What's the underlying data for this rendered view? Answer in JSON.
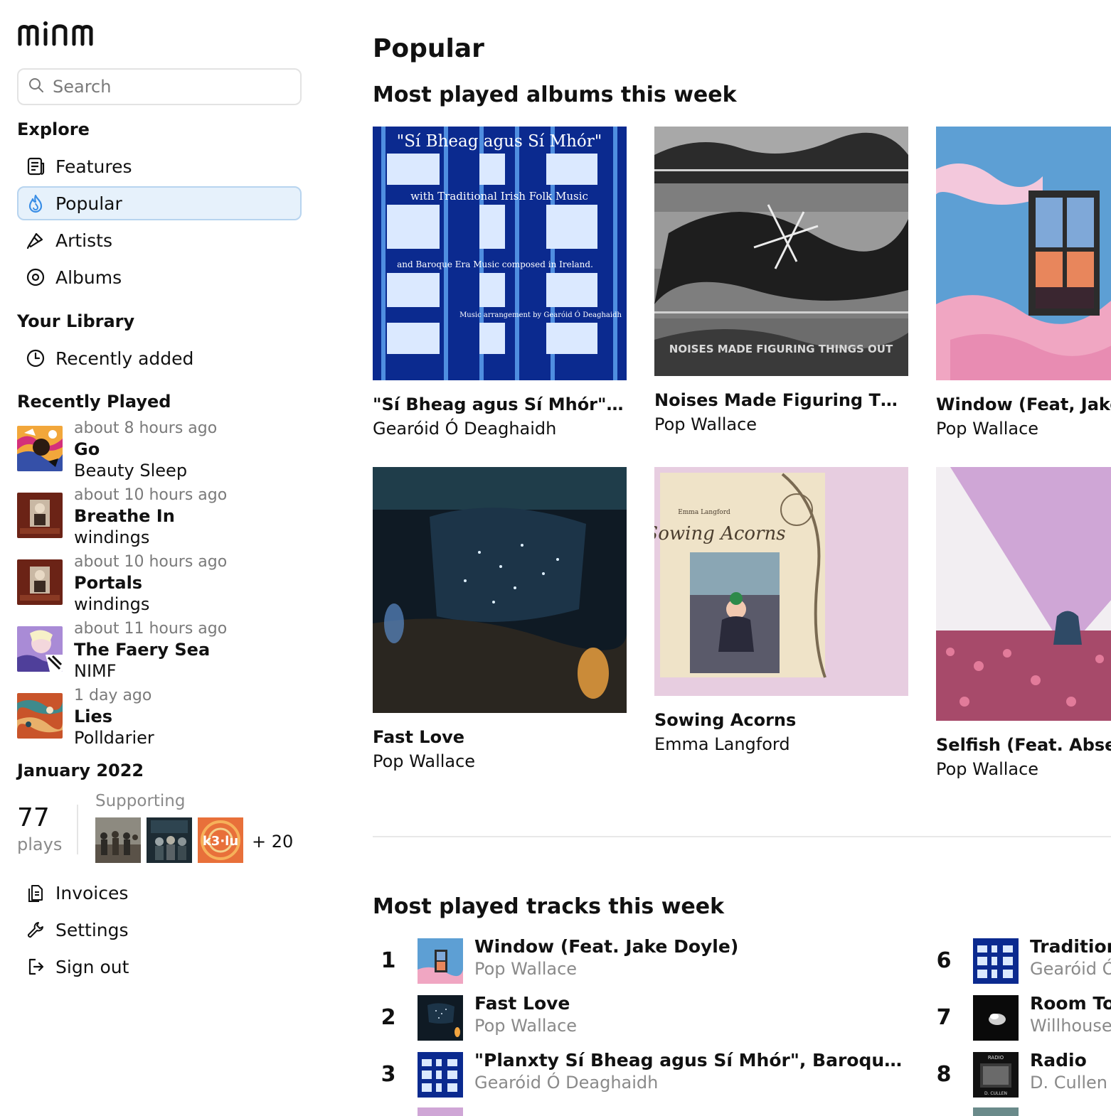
{
  "app": {
    "logo": "minm"
  },
  "search": {
    "placeholder": "Search"
  },
  "explore": {
    "heading": "Explore",
    "items": [
      {
        "label": "Features",
        "icon": "newspaper-icon"
      },
      {
        "label": "Popular",
        "icon": "flame-icon",
        "active": true
      },
      {
        "label": "Artists",
        "icon": "microphone-icon"
      },
      {
        "label": "Albums",
        "icon": "disc-icon"
      }
    ]
  },
  "library": {
    "heading": "Your Library",
    "items": [
      {
        "label": "Recently added",
        "icon": "clock-icon"
      }
    ]
  },
  "recently_played": {
    "heading": "Recently Played",
    "items": [
      {
        "time": "about 8 hours ago",
        "title": "Go",
        "artist": "Beauty Sleep"
      },
      {
        "time": "about 10 hours ago",
        "title": "Breathe In",
        "artist": "windings"
      },
      {
        "time": "about 10 hours ago",
        "title": "Portals",
        "artist": "windings"
      },
      {
        "time": "about 11 hours ago",
        "title": "The Faery Sea",
        "artist": "NIMF"
      },
      {
        "time": "1 day ago",
        "title": "Lies",
        "artist": "Polldarier"
      }
    ]
  },
  "stats": {
    "heading": "January 2022",
    "plays": "77",
    "plays_label": "plays",
    "supporting_label": "Supporting",
    "more": "+ 20"
  },
  "account": {
    "items": [
      {
        "label": "Invoices",
        "icon": "invoice-icon"
      },
      {
        "label": "Settings",
        "icon": "wrench-icon"
      },
      {
        "label": "Sign out",
        "icon": "sign-out-icon"
      }
    ]
  },
  "main": {
    "title": "Popular",
    "albums_heading": "Most played albums this week",
    "albums": [
      {
        "title": "\"Sí Bheag agus Sí Mhór\" with Traditional Irish Folk Music",
        "artist": "Gearóid Ó Deaghaidh",
        "cover_text": "\"Sí Bheag agus Sí Mhór\"",
        "cover_sub1": "with Traditional Irish Folk Music",
        "cover_sub2": "and Baroque Era Music composed in Ireland.",
        "cover_sub3": "Music arrangement by Gearóid Ó Deaghaidh"
      },
      {
        "title": "Noises Made Figuring Things Out",
        "artist": "Pop Wallace",
        "cover_text": "NOISES MADE FIGURING THINGS OUT"
      },
      {
        "title": "Window (Feat, Jake Doyle)",
        "artist": "Pop Wallace"
      },
      {
        "title": "Fast Love",
        "artist": "Pop Wallace"
      },
      {
        "title": "Sowing Acorns",
        "artist": "Emma Langford",
        "cover_text": "Sowing Acorns",
        "cover_small": "Emma Langford"
      },
      {
        "title": "Selfish (Feat. Absent)",
        "artist": "Pop Wallace"
      }
    ],
    "tracks_heading": "Most played tracks this week",
    "tracks": [
      {
        "rank": "1",
        "title": "Window (Feat. Jake Doyle)",
        "artist": "Pop Wallace"
      },
      {
        "rank": "2",
        "title": "Fast Love",
        "artist": "Pop Wallace"
      },
      {
        "rank": "3",
        "title": "\"Planxty Sí Bheag agus Sí Mhór\", Baroque Era music",
        "artist": "Gearóid Ó Deaghaidh"
      },
      {
        "rank": "6",
        "title": "Traditional",
        "artist": "Gearóid Ó Deaghaidh"
      },
      {
        "rank": "7",
        "title": "Room To",
        "artist": "Willhouse"
      },
      {
        "rank": "8",
        "title": "Radio",
        "artist": "D. Cullen",
        "cover_text": "RADIO",
        "cover_small": "D. CULLEN"
      }
    ]
  },
  "colors": {
    "active_bg": "#e6f1fb",
    "active_border": "#b7d4ef",
    "muted": "#8a8a8a",
    "accent_icon": "#3a8ee6"
  }
}
